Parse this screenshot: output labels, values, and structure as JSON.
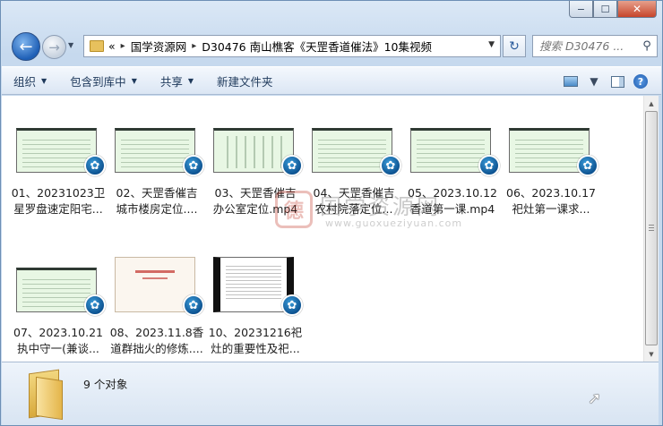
{
  "window": {
    "minimize_label": "−",
    "maximize_label": "☐",
    "close_label": "✕"
  },
  "nav": {
    "back_icon": "←",
    "forward_icon": "→",
    "history_icon": "▼",
    "breadcrumb_overflow": "«",
    "breadcrumb": [
      "国学资源网",
      "D30476 南山樵客《天罡香道催法》10集视频"
    ],
    "crumb_sep": "▸",
    "dropdown": "▼",
    "refresh_icon": "↻",
    "search_placeholder": "搜索 D30476 ...",
    "search_icon": "⚲"
  },
  "toolbar": {
    "organize": "组织",
    "include_library": "包含到库中",
    "share": "共享",
    "new_folder": "新建文件夹",
    "caret": "▼",
    "view_caret": "▼",
    "help": "?"
  },
  "files": [
    {
      "line1": "01、20231023卫",
      "line2": "星罗盘速定阳宅..."
    },
    {
      "line1": "02、天罡香催吉",
      "line2": "城市楼房定位...."
    },
    {
      "line1": "03、天罡香催吉",
      "line2": "办公室定位.mp4"
    },
    {
      "line1": "04、天罡香催吉",
      "line2": "农村院落定位..."
    },
    {
      "line1": "05、2023.10.12",
      "line2": "香道第一课.mp4"
    },
    {
      "line1": "06、2023.10.17",
      "line2": "祀灶第一课求..."
    },
    {
      "line1": "07、2023.10.21",
      "line2": "执中守一(兼谈..."
    },
    {
      "line1": "08、2023.11.8香",
      "line2": "道群拙火的修炼...."
    },
    {
      "line1": "10、20231216祀",
      "line2": "灶的重要性及祀..."
    }
  ],
  "badge_icon": "✿",
  "watermark": {
    "seal": "德",
    "cn": "国学资源网",
    "en": "www.guoxueziyuan.com"
  },
  "status": {
    "count": "9 个对象"
  },
  "scrollbar": {
    "up": "▲",
    "down": "▼"
  }
}
